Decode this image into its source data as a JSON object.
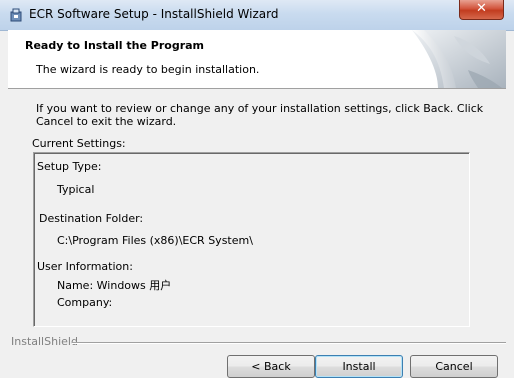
{
  "window": {
    "title": "ECR Software Setup - InstallShield Wizard",
    "close_label": "✕",
    "app_icon": "installer-icon"
  },
  "header": {
    "title": "Ready to Install the Program",
    "subtitle": "The wizard is ready to begin installation."
  },
  "body": {
    "intro": "If you want to review or change any of your installation settings, click Back. Click Cancel to exit the wizard.",
    "current_settings_label": "Current Settings:"
  },
  "settings": {
    "setup_type_label": "Setup Type:",
    "setup_type_value": "Typical",
    "destination_label": "Destination Folder:",
    "destination_value": "C:\\Program Files (x86)\\ECR System\\",
    "user_info_label": "User Information:",
    "name_line": "Name: Windows 用户",
    "company_line": "Company:"
  },
  "footer": {
    "brand": "InstallShield",
    "back_label": "< Back",
    "install_label": "Install",
    "cancel_label": "Cancel"
  },
  "colors": {
    "titlebar": "#c9dbef",
    "close_button": "#c23c1f",
    "dialog_bg": "#f0f0f0",
    "header_bg": "#ffffff"
  }
}
